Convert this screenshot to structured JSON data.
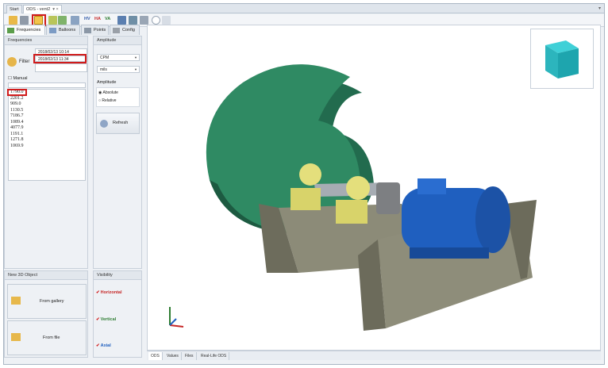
{
  "tabs": [
    {
      "label": "Start"
    },
    {
      "label": "ODS - vent2",
      "active": true
    }
  ],
  "toolbar": {
    "hv": "HV",
    "ha": "HA",
    "va": "VA",
    "accent_hv": "#2f5aa8",
    "accent_ha": "#c62828",
    "accent_va": "#2e7d32"
  },
  "panel_tabs": [
    {
      "label": "Frequencies",
      "active": true,
      "icon": "bar-chart-icon"
    },
    {
      "label": "Balloons",
      "icon": "balloon-icon"
    },
    {
      "label": "Points",
      "icon": "points-icon"
    },
    {
      "label": "Config",
      "icon": "gear-icon"
    }
  ],
  "frequencies": {
    "header": "Frequencies",
    "filter_label": "Filter",
    "date_from": "2018/02/13 10:14",
    "date_to": "2018/02/13 11:34",
    "manual_label": "Manual",
    "list": [
      "1790.0",
      "2201.2",
      "909.0",
      "1130.5",
      "7186.7",
      "1089.4",
      "4077.9",
      "1191.1",
      "1271.8",
      "1069.9"
    ]
  },
  "amplitude": {
    "header": "Amplitude",
    "unit_select": "CPM",
    "scale_select": "mils",
    "group_label": "Amplitude",
    "absolute_label": "Absolute",
    "relative_label": "Relative",
    "refresh_label": "Refresh"
  },
  "new3d": {
    "header": "New 3D Object",
    "from_gallery": "From gallery",
    "from_file": "From file"
  },
  "visibility": {
    "header": "Visibility",
    "horizontal": "Horizontal",
    "vertical": "Vertical",
    "axial": "Axial",
    "horizontal_color": "#c62828",
    "vertical_color": "#2e7d32",
    "axial_color": "#1e5fbf"
  },
  "view_tabs": [
    {
      "label": "ODS",
      "active": true
    },
    {
      "label": "Values"
    },
    {
      "label": "Files"
    },
    {
      "label": "Real-Life ODS"
    }
  ]
}
